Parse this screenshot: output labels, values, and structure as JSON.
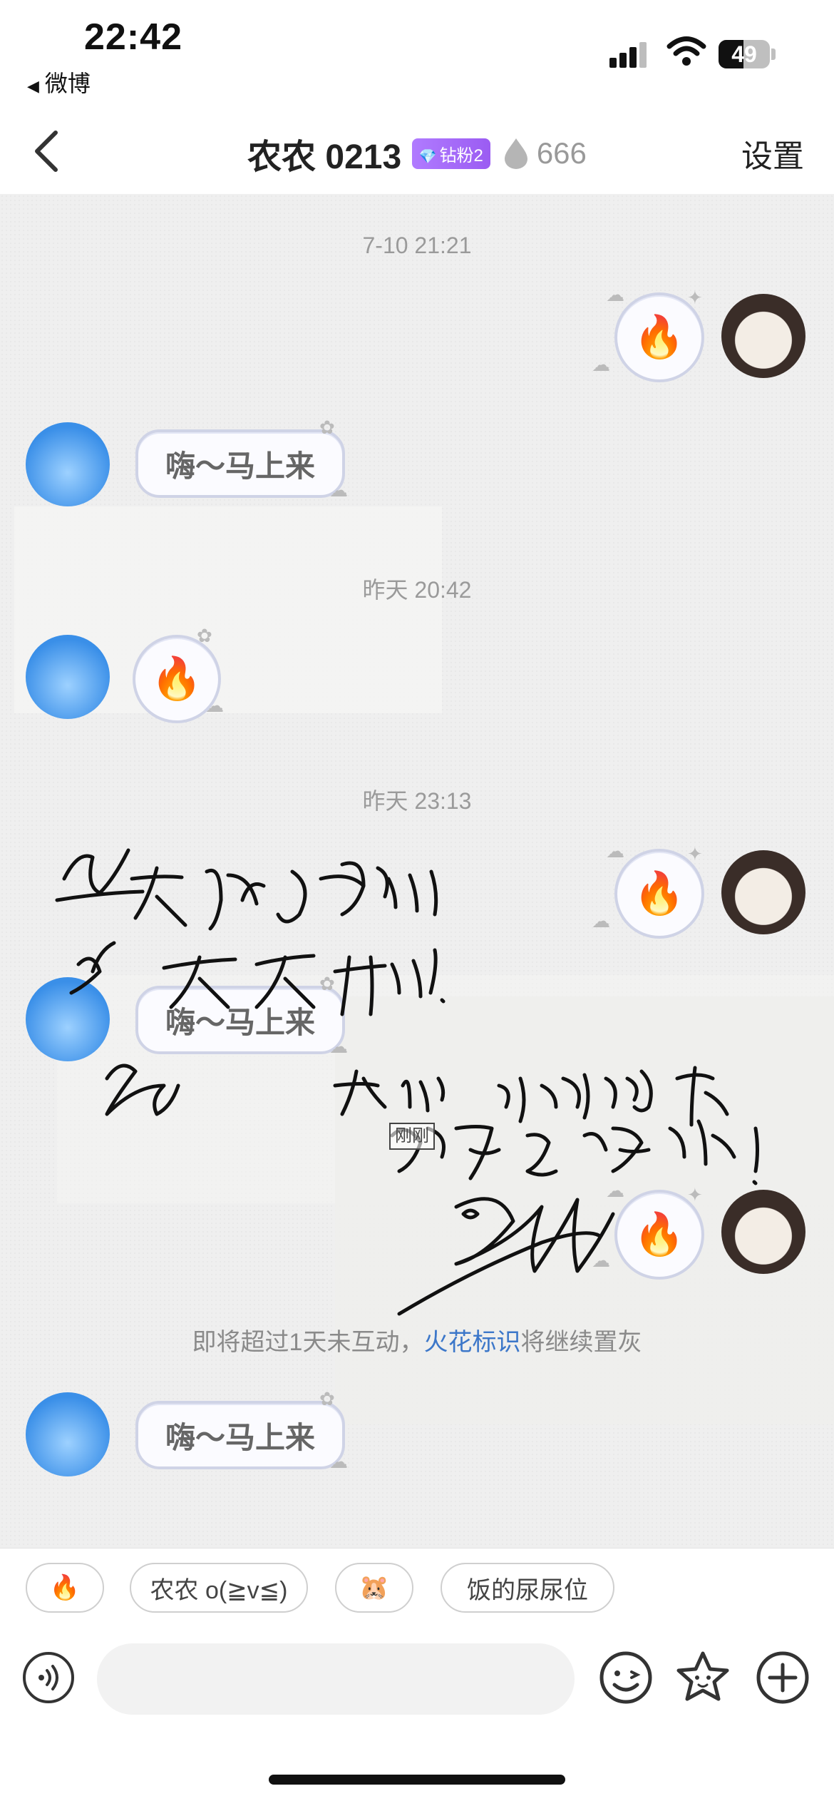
{
  "status_bar": {
    "time": "22:42",
    "back_app": "微博",
    "battery": "49",
    "battery_fraction": 0.49
  },
  "nav": {
    "title": "农农 0213",
    "fan_badge": "钻粉2",
    "fire_count": "666",
    "settings": "设置"
  },
  "timestamps": [
    "7-10 21:21",
    "昨天 20:42",
    "昨天 23:13"
  ],
  "messages": [
    {
      "side": "right",
      "kind": "fire-icon",
      "text": "🔥"
    },
    {
      "side": "left",
      "kind": "text",
      "text": "嗨～马上来"
    },
    {
      "side": "left",
      "kind": "fire-icon",
      "text": "🔥"
    },
    {
      "side": "right",
      "kind": "fire-icon",
      "text": "🔥"
    },
    {
      "side": "left",
      "kind": "text",
      "text": "嗨～马上来"
    },
    {
      "side": "right",
      "kind": "fire-icon",
      "text": "🔥"
    },
    {
      "side": "left",
      "kind": "text",
      "text": "嗨～马上来"
    }
  ],
  "handwriting": {
    "line1": "每天都有好心",
    "line2": "情 天天开心！",
    "line3": "开心，珍惜当下",
    "line4": "为自己而活！",
    "stamp": "刚刚"
  },
  "notice": {
    "before": "即将超过1天未互动，",
    "link": "火花标识",
    "after": "将继续置灰"
  },
  "quick_replies": [
    "🔥",
    "农农 o(≧v≦)",
    "🐹",
    "饭的尿尿位"
  ],
  "input": {
    "placeholder": ""
  },
  "colors": {
    "accent": "#3c77c9",
    "badge": "#a46cf7",
    "chat_bg": "#efefef"
  }
}
